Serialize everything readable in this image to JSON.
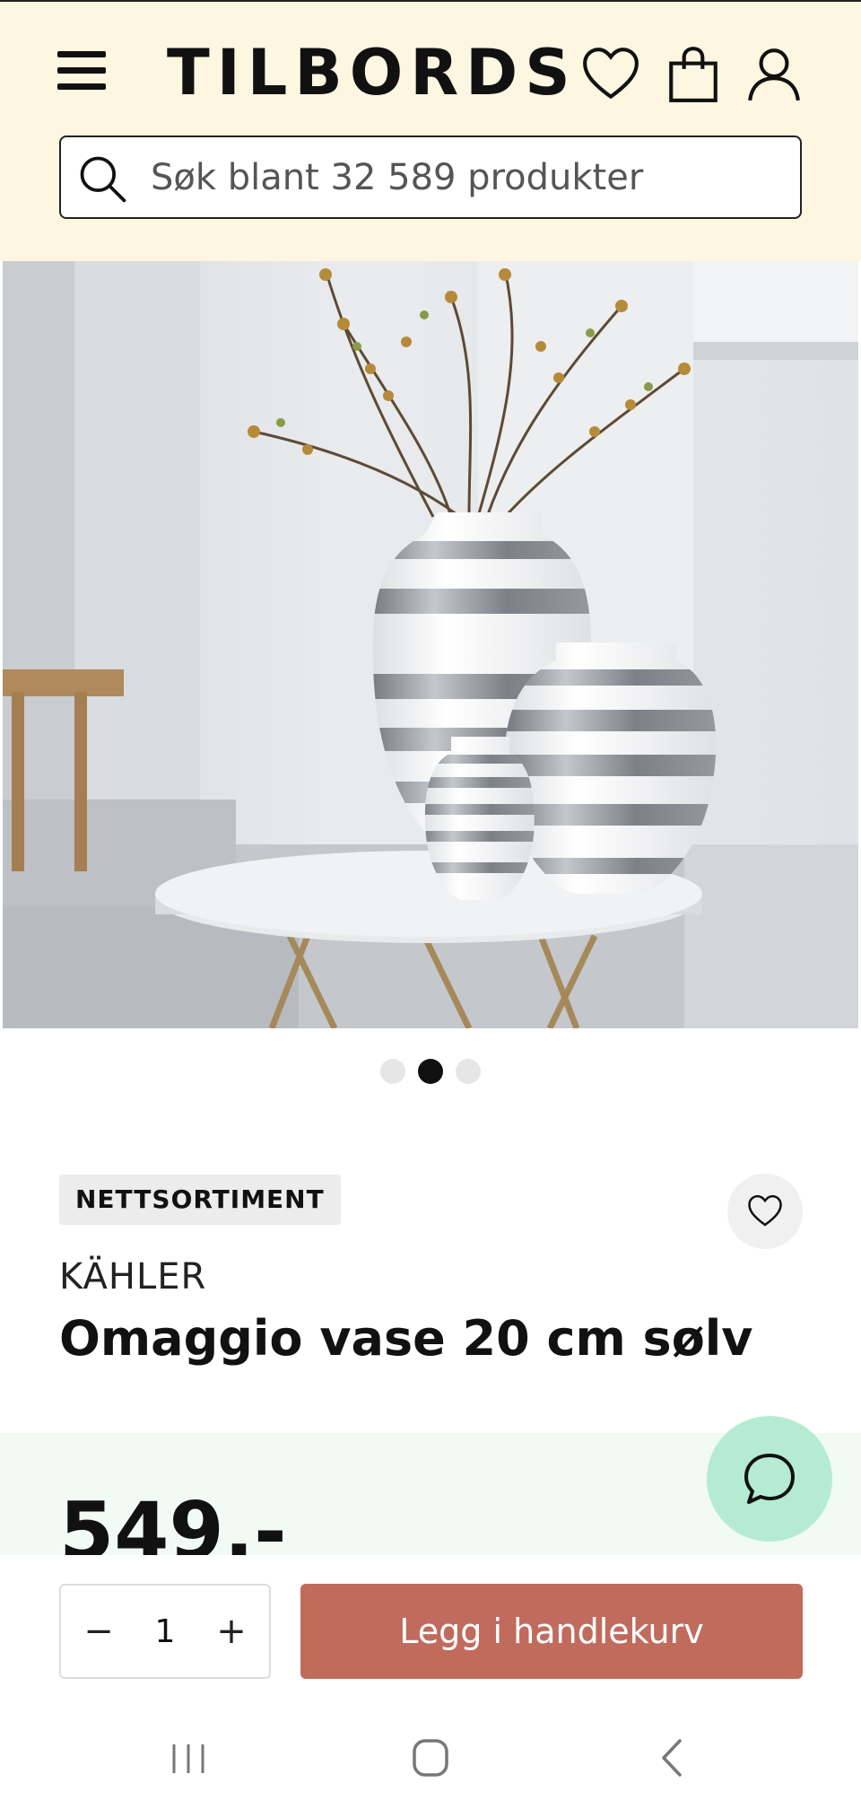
{
  "header": {
    "logo": "TILBORDS",
    "search_placeholder": "Søk blant 32 589 produkter"
  },
  "carousel": {
    "total": 3,
    "active_index": 1
  },
  "product": {
    "badge": "NETTSORTIMENT",
    "brand": "KÄHLER",
    "title": "Omaggio vase 20 cm sølv",
    "price": "549.-"
  },
  "purchase": {
    "minus": "−",
    "quantity": "1",
    "plus": "+",
    "add_to_cart": "Legg i handlekurv"
  },
  "colors": {
    "header_bg": "#fdf6e1",
    "cart_button": "#c16b5d",
    "chat_button": "#b5ebd3",
    "price_band": "#f2faf6"
  }
}
